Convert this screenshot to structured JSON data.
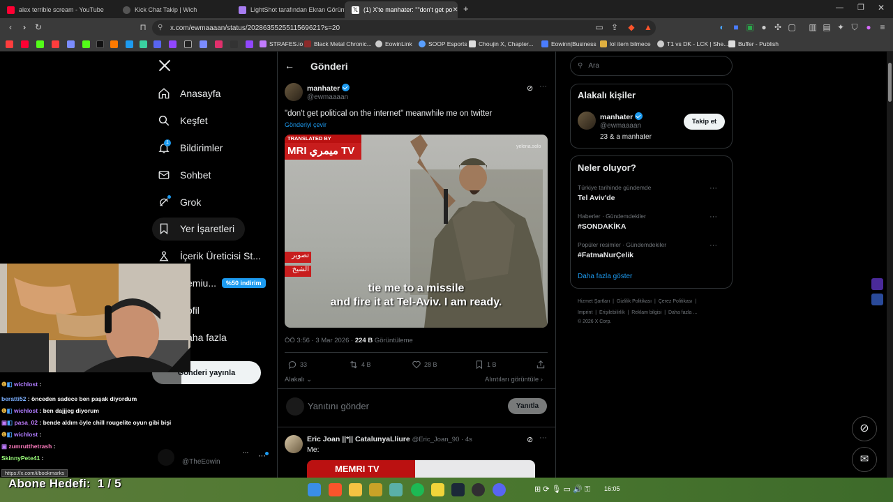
{
  "browser": {
    "tabs": [
      {
        "title": "alex terrible scream - YouTube",
        "color": "#ff0033"
      },
      {
        "title": "Kick Chat Takip | Wich",
        "color": "#aaaaaa"
      },
      {
        "title": "LightShot tarafından Ekran Görüntüs",
        "color": "#a77cf0"
      },
      {
        "title": "(1) X'te manhater: \"\"don't get po",
        "color": "#ffffff"
      }
    ],
    "new_tab": "+",
    "url": "x.com/ewmaaaan/status/2028635525511569621?s=20",
    "bookmarks": [
      "STRAFES.io",
      "Black Metal Chronic...",
      "EowinLink",
      "SOOP Esports",
      "Choujin X, Chapter...",
      "Eowinn|Business",
      "lol item bilmece",
      "T1 vs DK - LCK | She...",
      "Buffer - Publish"
    ],
    "status_url": "https://x.com/i/bookmarks"
  },
  "nav": {
    "items": [
      {
        "label": "Anasayfa",
        "icon": "home-icon"
      },
      {
        "label": "Keşfet",
        "icon": "search-icon"
      },
      {
        "label": "Bildirimler",
        "icon": "bell-icon",
        "badge": "1"
      },
      {
        "label": "Sohbet",
        "icon": "mail-icon"
      },
      {
        "label": "Grok",
        "icon": "grok-icon"
      },
      {
        "label": "Yer İşaretleri",
        "icon": "bookmark-icon"
      },
      {
        "label": "İçerik Üreticisi St...",
        "icon": "creator-icon"
      },
      {
        "label": "emiu...",
        "icon": "premium-icon",
        "badge": "%50 indirim"
      },
      {
        "label": "ofil",
        "icon": "profile-icon"
      },
      {
        "label": "aha fazla",
        "icon": "more-icon"
      }
    ],
    "post_button": "Gönderi yayınla",
    "account_handle": "@TheEowin",
    "account_more": "..."
  },
  "main": {
    "header": "Gönderi",
    "tweet": {
      "name": "manhater",
      "handle": "@ewmaaaan",
      "text": "\"don't get political on the internet\" meanwhile me on twitter",
      "translate": "Gönderiyi çevir",
      "media_badge": "TRANSLATED BY",
      "media_logo": "MRI ميمري TV",
      "media_watermark": "yelena.solo",
      "media_arabic_1": "تصوير",
      "media_arabic_2": "الشيخ",
      "subtitle_line1": "tie me to a missile",
      "subtitle_line2": "and fire it at Tel-Aviv. I am ready.",
      "time": "ÖÖ 3:56 · 3 Mar 2026 ·",
      "views_count": "224 B",
      "views_label": "Görüntüleme",
      "replies": "33",
      "reposts": "4 B",
      "likes": "28 B",
      "bookmarks": "1 B",
      "relevance": "Alakalı",
      "quotes": "Alıntıları görüntüle"
    },
    "reply_placeholder": "Yanıtını gönder",
    "reply_button": "Yanıtla",
    "reply_tweet": {
      "name": "Eric Joan ||*|| CatalunyaLliure",
      "handle": "@Eric_Joan_90 · 4s",
      "text": "Me:",
      "media_logo": "MEMRI TV"
    }
  },
  "right": {
    "search_placeholder": "Ara",
    "related_title": "Alakalı kişiler",
    "related_name": "manhater",
    "related_handle": "@ewmaaaan",
    "related_bio": "23 & a manhater",
    "follow_button": "Takip et",
    "trends_title": "Neler oluyor?",
    "trends": [
      {
        "meta": "Türkiye tarihinde gündemde",
        "title": "Tel Aviv'de"
      },
      {
        "meta": "Haberler · Gündemdekiler",
        "title": "#SONDAKİKA"
      },
      {
        "meta": "Popüler resimler · Gündemdekiler",
        "title": "#FatmaNurÇelik"
      }
    ],
    "show_more": "Daha fazla göster",
    "footer_line1": [
      "Hizmet Şartları",
      "Gizlilik Politikası",
      "Çerez Politikası"
    ],
    "footer_line2": [
      "Imprint",
      "Erişilebilirlik",
      "Reklam bilgisi",
      "Daha fazla ..."
    ],
    "copyright": "© 2026 X Corp."
  },
  "stream": {
    "chat": [
      {
        "user": "wichlost",
        "msg": ":",
        "color": "#b07cff",
        "extra": ""
      },
      {
        "user": "beratti52",
        "msg": ": önceden sadece ben paşak diyordum",
        "color": "#7cb0ff",
        "extra": ""
      },
      {
        "user": "wichlost",
        "msg": ": ben dajjjeg diyorum",
        "color": "#b07cff",
        "extra": ""
      },
      {
        "user": "pasa_02",
        "msg": ": bende aldım öyle chill rougelite oyun gibi bişi",
        "color": "#c07cff",
        "extra": ""
      },
      {
        "user": "wichlost",
        "msg": ":",
        "color": "#b07cff",
        "extra": ""
      },
      {
        "user": "zumrutthetrash",
        "msg": ":",
        "color": "#ff7cc0",
        "extra": ""
      },
      {
        "user": "SkinnyPete41",
        "msg": ":",
        "color": "#9cff7c",
        "extra": ""
      }
    ],
    "goal_label": "Abone Hedefi:",
    "goal_value": "1 / 5"
  },
  "taskbar": {
    "clock": "16:05"
  }
}
